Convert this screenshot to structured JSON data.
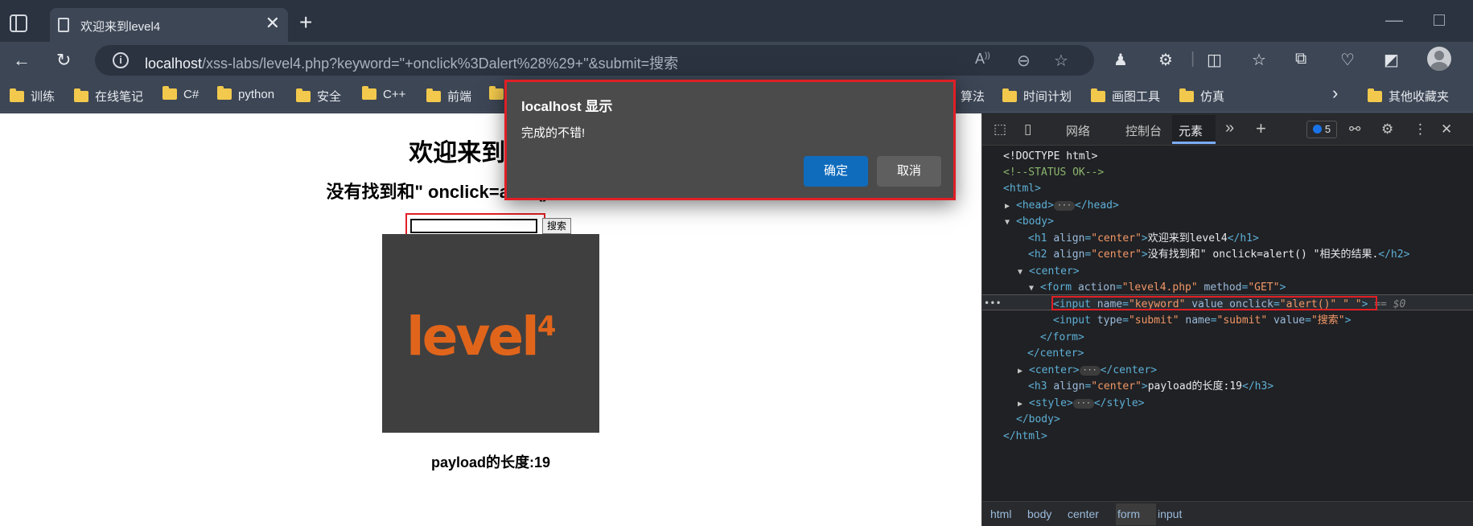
{
  "browser": {
    "tab_title": "欢迎来到level4",
    "tab_close": "✕",
    "new_tab": "+",
    "url_host": "localhost",
    "url_path": "/xss-labs/level4.php?keyword=\"+onclick%3Dalert%28%29+\"&submit=搜索",
    "info_glyph": "i",
    "nav_icons": [
      "back-icon",
      "refresh-icon"
    ],
    "omnibox_icons": [
      "read-aloud-icon",
      "zoom-out-icon",
      "favorite-star-icon"
    ],
    "extension_icons": [
      "extension-user-icon",
      "extensions-puzzle-icon",
      "split-screen-icon",
      "favorites-icon",
      "collections-icon",
      "performance-icon",
      "copilot-icon",
      "profile-avatar"
    ]
  },
  "bookmarks": [
    "训练",
    "在线笔记",
    "C#",
    "python",
    "安全",
    "C++",
    "前端",
    "算法",
    "时间计划",
    "画图工具",
    "仿真"
  ],
  "bookmarks_more": "›",
  "bookmarks_other": "其他收藏夹",
  "page": {
    "h1": "欢迎来到level4",
    "h2": "没有找到和\" onclick=alert() \"相关的结果.",
    "keyword_value": "",
    "submit_label": "搜索",
    "logo_text": "level",
    "logo_sup": "4",
    "h3": "payload的长度:19"
  },
  "dialog": {
    "title": "localhost 显示",
    "message": "完成的不错!",
    "ok_label": "确定",
    "cancel_label": "取消"
  },
  "devtools": {
    "tabs": [
      "网络",
      "控制台",
      "元素"
    ],
    "active_tab": "元素",
    "more": "»",
    "add": "+",
    "issues_count": "5",
    "dom": {
      "doctype": "<!DOCTYPE html>",
      "comment": "<!--STATUS OK-->",
      "html_open": "<html>",
      "head_open": "<head>",
      "head_close": "</head>",
      "body_open": "<body>",
      "h1_text": "欢迎来到level4",
      "h2_text": "没有找到和\" onclick=alert() \"相关的结果.",
      "center_open": "<center>",
      "form_action": "level4.php",
      "form_method": "GET",
      "input1_name": "keyword",
      "input1_onclick": "alert()",
      "input1_extra": "\" \"",
      "eq_dollar": "== $0",
      "input2_type": "submit",
      "input2_name": "submit",
      "input2_value": "搜索",
      "form_close": "</form>",
      "center_close": "</center>",
      "h3_text": "payload的长度:19",
      "style_open": "<style>",
      "style_close": "</style>",
      "body_close": "</body>",
      "html_close": "</html>"
    },
    "breadcrumbs": [
      "html",
      "body",
      "center",
      "form",
      "input"
    ]
  }
}
